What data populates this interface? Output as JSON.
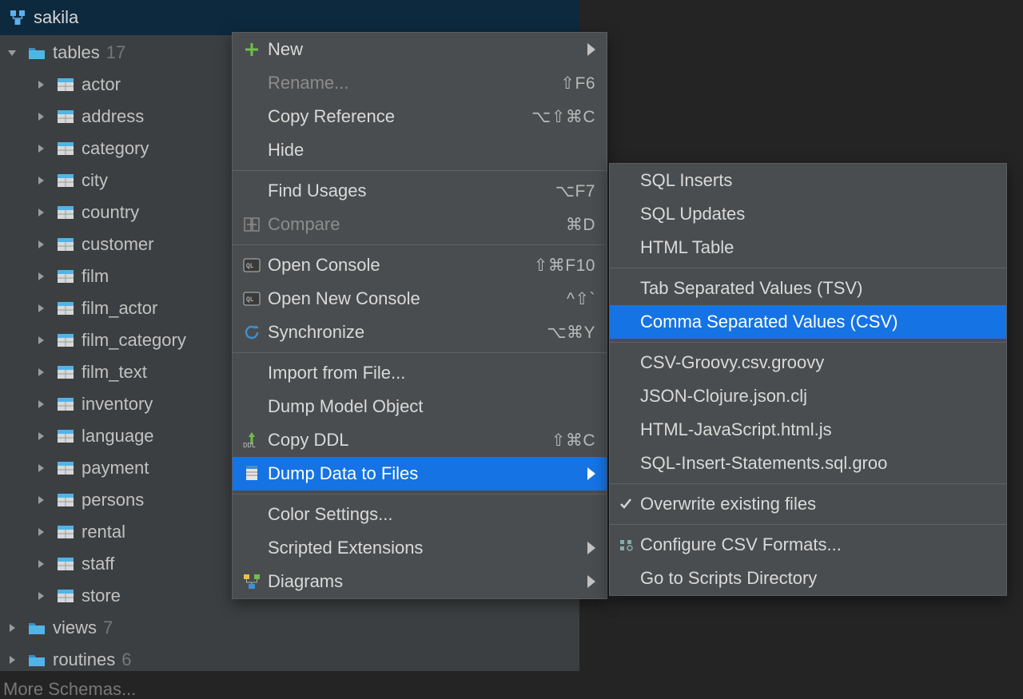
{
  "database": {
    "name": "sakila"
  },
  "tree": {
    "tables_label": "tables",
    "tables_count": "17",
    "tables": [
      "actor",
      "address",
      "category",
      "city",
      "country",
      "customer",
      "film",
      "film_actor",
      "film_category",
      "film_text",
      "inventory",
      "language",
      "payment",
      "persons",
      "rental",
      "staff",
      "store"
    ],
    "views_label": "views",
    "views_count": "7",
    "routines_label": "routines",
    "routines_count": "6",
    "more_label": "More Schemas..."
  },
  "menu": {
    "new": "New",
    "rename": "Rename...",
    "rename_short": "⇧F6",
    "copy_ref": "Copy Reference",
    "copy_ref_short": "⌥⇧⌘C",
    "hide": "Hide",
    "find_usages": "Find Usages",
    "find_usages_short": "⌥F7",
    "compare": "Compare",
    "compare_short": "⌘D",
    "open_console": "Open Console",
    "open_console_short": "⇧⌘F10",
    "open_new_console": "Open New Console",
    "open_new_console_short": "^⇧`",
    "synchronize": "Synchronize",
    "synchronize_short": "⌥⌘Y",
    "import_file": "Import from File...",
    "dump_model": "Dump Model Object",
    "copy_ddl": "Copy DDL",
    "copy_ddl_short": "⇧⌘C",
    "dump_data": "Dump Data to Files",
    "color_settings": "Color Settings...",
    "scripted_ext": "Scripted Extensions",
    "diagrams": "Diagrams"
  },
  "submenu": {
    "sql_inserts": "SQL Inserts",
    "sql_updates": "SQL Updates",
    "html_table": "HTML Table",
    "tsv": "Tab Separated Values (TSV)",
    "csv": "Comma Separated Values (CSV)",
    "csv_groovy": "CSV-Groovy.csv.groovy",
    "json_clojure": "JSON-Clojure.json.clj",
    "html_js": "HTML-JavaScript.html.js",
    "sql_ins_groovy": "SQL-Insert-Statements.sql.groo",
    "overwrite": "Overwrite existing files",
    "configure_csv": "Configure CSV Formats...",
    "goto_scripts": "Go to Scripts Directory"
  }
}
